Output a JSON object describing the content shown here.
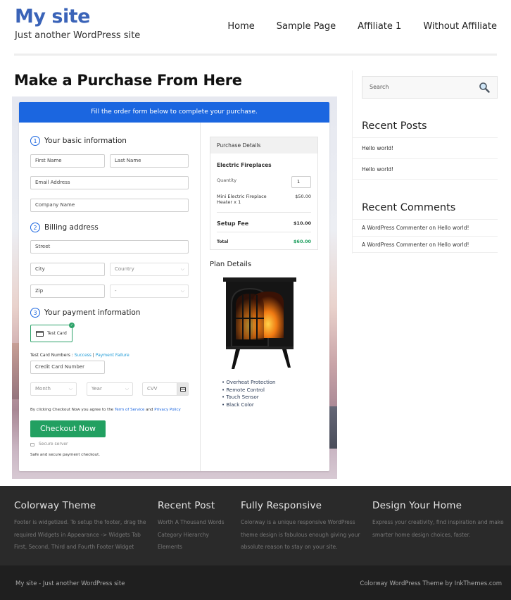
{
  "header": {
    "site_title": "My site",
    "tagline": "Just another WordPress site",
    "nav": [
      {
        "label": "Home"
      },
      {
        "label": "Sample Page"
      },
      {
        "label": "Affiliate 1"
      },
      {
        "label": "Without Affiliate"
      }
    ]
  },
  "main": {
    "page_title": "Make a Purchase From Here",
    "form": {
      "banner": "Fill the order form below to complete your purchase.",
      "steps": [
        {
          "num": "1",
          "label": "Your basic information"
        },
        {
          "num": "2",
          "label": "Billing address"
        },
        {
          "num": "3",
          "label": "Your payment information"
        }
      ],
      "fields": {
        "first_name": "First Name",
        "last_name": "Last Name",
        "email": "Email Address",
        "company": "Company Name",
        "street": "Street",
        "city": "City",
        "country": "Country",
        "zip": "Zip",
        "state": "-",
        "credit_card": "Credit Card Number",
        "month": "Month",
        "year": "Year",
        "cvv": "CVV"
      },
      "payment_method": "Test Card",
      "test_cards": {
        "prefix": "Test Card Numbers : ",
        "success": "Success",
        "separator": " | ",
        "failure": "Payment Failure"
      },
      "terms": {
        "prefix": "By clicking Checkout Now you agree to the ",
        "tos": "Term of Service",
        "and": " and ",
        "privacy": "Privacy Policy"
      },
      "checkout_label": "Checkout Now",
      "secure_server": "Secure server",
      "secure_note": "Safe and secure payment checkout."
    },
    "purchase": {
      "heading": "Purchase Details",
      "product_group": "Electric Fireplaces",
      "quantity_label": "Quantity",
      "quantity_value": "1",
      "item_line1": "Mini Electric Fireplace",
      "item_line2": "Heater x 1",
      "item_price": "$50.00",
      "setup_fee_label": "Setup Fee",
      "setup_fee": "$10.00",
      "total_label": "Total",
      "total": "$60.00",
      "total_color": "#22a061"
    },
    "plan": {
      "title": "Plan Details",
      "features": [
        "Overheat Protection",
        "Remote Control",
        "Touch Sensor",
        "Black Color"
      ]
    }
  },
  "sidebar": {
    "search_placeholder": "Search",
    "recent_posts_title": "Recent Posts",
    "recent_posts": [
      "Hello world!",
      "Hello world!"
    ],
    "recent_comments_title": "Recent Comments",
    "recent_comments": [
      "A WordPress Commenter on Hello world!",
      "A WordPress Commenter on Hello world!"
    ]
  },
  "footer": {
    "columns": [
      {
        "title": "Colorway Theme",
        "lines": [
          "Footer is widgetized. To setup the footer, drag the",
          "required Widgets in Appearance -> Widgets Tab",
          "First, Second, Third and Fourth Footer Widget"
        ]
      },
      {
        "title": "Recent Post",
        "lines": [
          "Worth A Thousand Words",
          "Category Hierarchy",
          "Elements"
        ]
      },
      {
        "title": "Fully Responsive",
        "lines": [
          "Colorway is a unique responsive WordPress",
          "theme design is fabulous enough giving your",
          "absolute reason to stay on your site."
        ]
      },
      {
        "title": "Design Your Home",
        "lines": [
          "Express your creativity, find inspiration and make",
          "smarter home design choices, faster."
        ]
      }
    ],
    "bottom_left": "My site - Just another WordPress site",
    "bottom_right": "Colorway WordPress Theme by InkThemes.com"
  },
  "colors": {
    "brand_blue": "#3a63b8",
    "banner_blue": "#1b66e0",
    "checkout_green": "#22a061"
  }
}
